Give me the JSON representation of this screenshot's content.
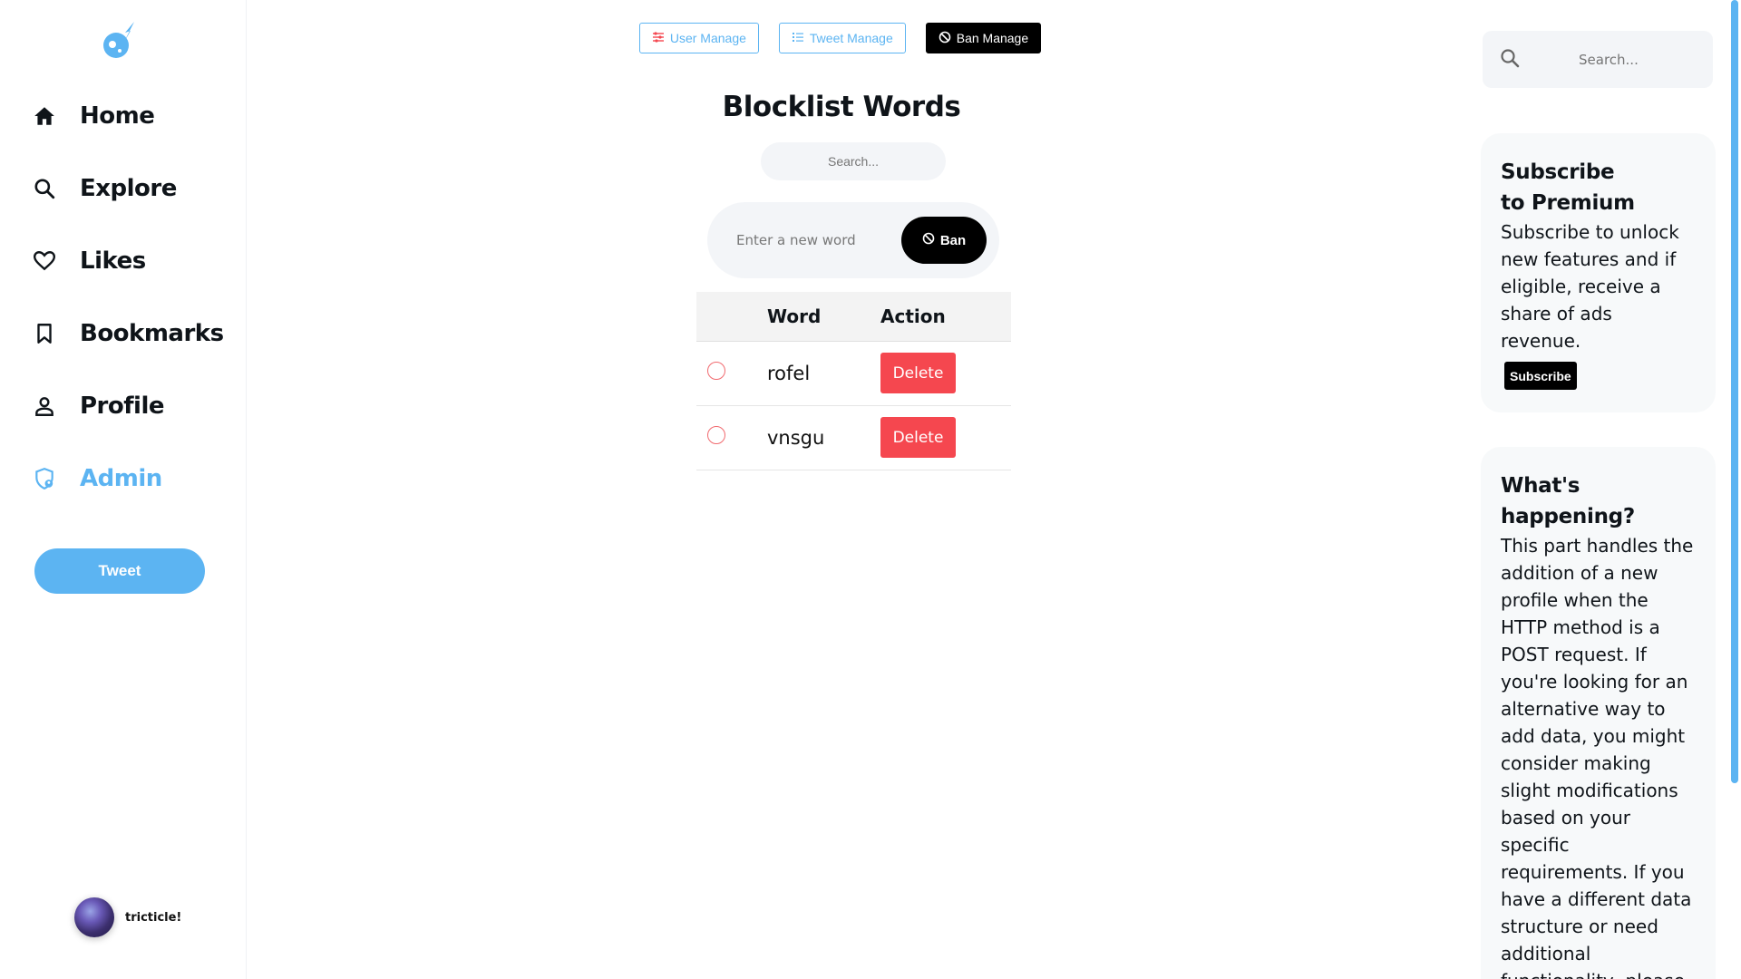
{
  "sidebar": {
    "items": [
      {
        "label": "Home",
        "icon": "home-icon"
      },
      {
        "label": "Explore",
        "icon": "search-icon"
      },
      {
        "label": "Likes",
        "icon": "heart-icon"
      },
      {
        "label": "Bookmarks",
        "icon": "bookmark-icon"
      },
      {
        "label": "Profile",
        "icon": "user-icon"
      },
      {
        "label": "Admin",
        "icon": "shield-icon",
        "active": true
      }
    ],
    "tweet_label": "Tweet",
    "username": "tricticle!"
  },
  "main": {
    "tabs": [
      {
        "label": "User Manage",
        "icon": "sliders-icon"
      },
      {
        "label": "Tweet Manage",
        "icon": "list-icon"
      },
      {
        "label": "Ban Manage",
        "icon": "ban-icon",
        "active": true
      }
    ],
    "title": "Blocklist Words",
    "search_placeholder": "Search...",
    "word_placeholder": "Enter a new word",
    "ban_label": "Ban",
    "table": {
      "headers": [
        "",
        "Word",
        "Action"
      ],
      "rows": [
        {
          "word": "rofel",
          "action": "Delete"
        },
        {
          "word": "vnsgu",
          "action": "Delete"
        }
      ]
    }
  },
  "right": {
    "search_placeholder": "Search...",
    "premium": {
      "title_line1": "Subscribe",
      "title_line2": "to Premium",
      "text": "Subscribe to unlock new features and if eligible, receive a share of ads revenue.",
      "button": "Subscribe"
    },
    "happening": {
      "title_line1": "What's",
      "title_line2": "happening?",
      "text": "This part handles the addition of a new profile when the HTTP method is a POST request. If you're looking for an alternative way to add data, you might consider making slight modifications based on your specific requirements. If you have a different data structure or need additional functionality, please"
    }
  },
  "colors": {
    "accent": "#5cb4f2",
    "danger": "#f5474f",
    "active_tab": "#000000"
  }
}
